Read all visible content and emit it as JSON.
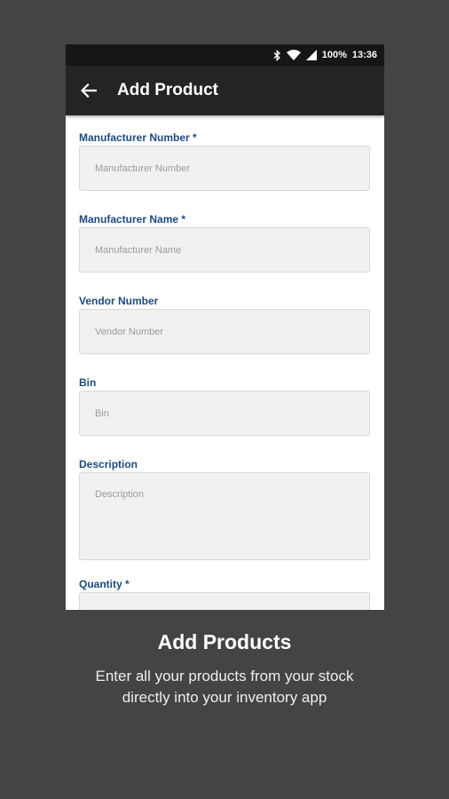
{
  "status": {
    "battery": "100%",
    "time": "13:36"
  },
  "appbar": {
    "title": "Add Product"
  },
  "form": {
    "fields": [
      {
        "label": "Manufacturer Number *",
        "placeholder": "Manufacturer Number"
      },
      {
        "label": "Manufacturer Name *",
        "placeholder": "Manufacturer Name"
      },
      {
        "label": "Vendor Number",
        "placeholder": "Vendor Number"
      },
      {
        "label": "Bin",
        "placeholder": "Bin"
      },
      {
        "label": "Description",
        "placeholder": "Description"
      },
      {
        "label": "Quantity *"
      }
    ]
  },
  "caption": {
    "headline": "Add Products",
    "line1": "Enter all your products from your stock",
    "line2": "directly into your inventory app"
  }
}
